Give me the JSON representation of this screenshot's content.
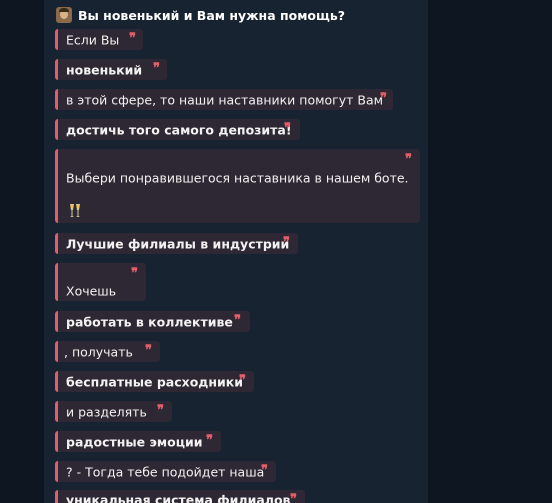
{
  "header": {
    "title": "Вы новенький и Вам нужна помощь?",
    "emoji": "man-face-emoji"
  },
  "quotes": [
    {
      "text": "Если Вы",
      "bold": false
    },
    {
      "text": "новенький",
      "bold": true
    },
    {
      "text": " в этой сфере, то наши наставники помогут Вам",
      "bold": false
    },
    {
      "text": "достичь того самого депозита!",
      "bold": true
    },
    {
      "text": "Выбери понравившегося наставника в нашем боте.",
      "bold": false,
      "emoji": "champagne-glasses-emoji"
    },
    {
      "text": "Лучшие филиалы в индустрии",
      "bold": true
    },
    {
      "text": "Хочешь",
      "bold": false
    },
    {
      "text": " работать в коллективе",
      "bold": true
    },
    {
      "text": ", получать",
      "bold": false
    },
    {
      "text": "бесплатные расходники",
      "bold": true
    },
    {
      "text": " и разделять",
      "bold": false
    },
    {
      "text": "радостные эмоции",
      "bold": true
    },
    {
      "text": "? - Тогда тебе подойдет наша",
      "bold": false
    },
    {
      "text": "уникальная система филиалов",
      "bold": true
    }
  ],
  "quote_mark": "❞",
  "colors": {
    "background": "#0e1621",
    "bubble": "#172331",
    "quote_bg": "#2d2833",
    "quote_accent": "#e35d6a"
  }
}
